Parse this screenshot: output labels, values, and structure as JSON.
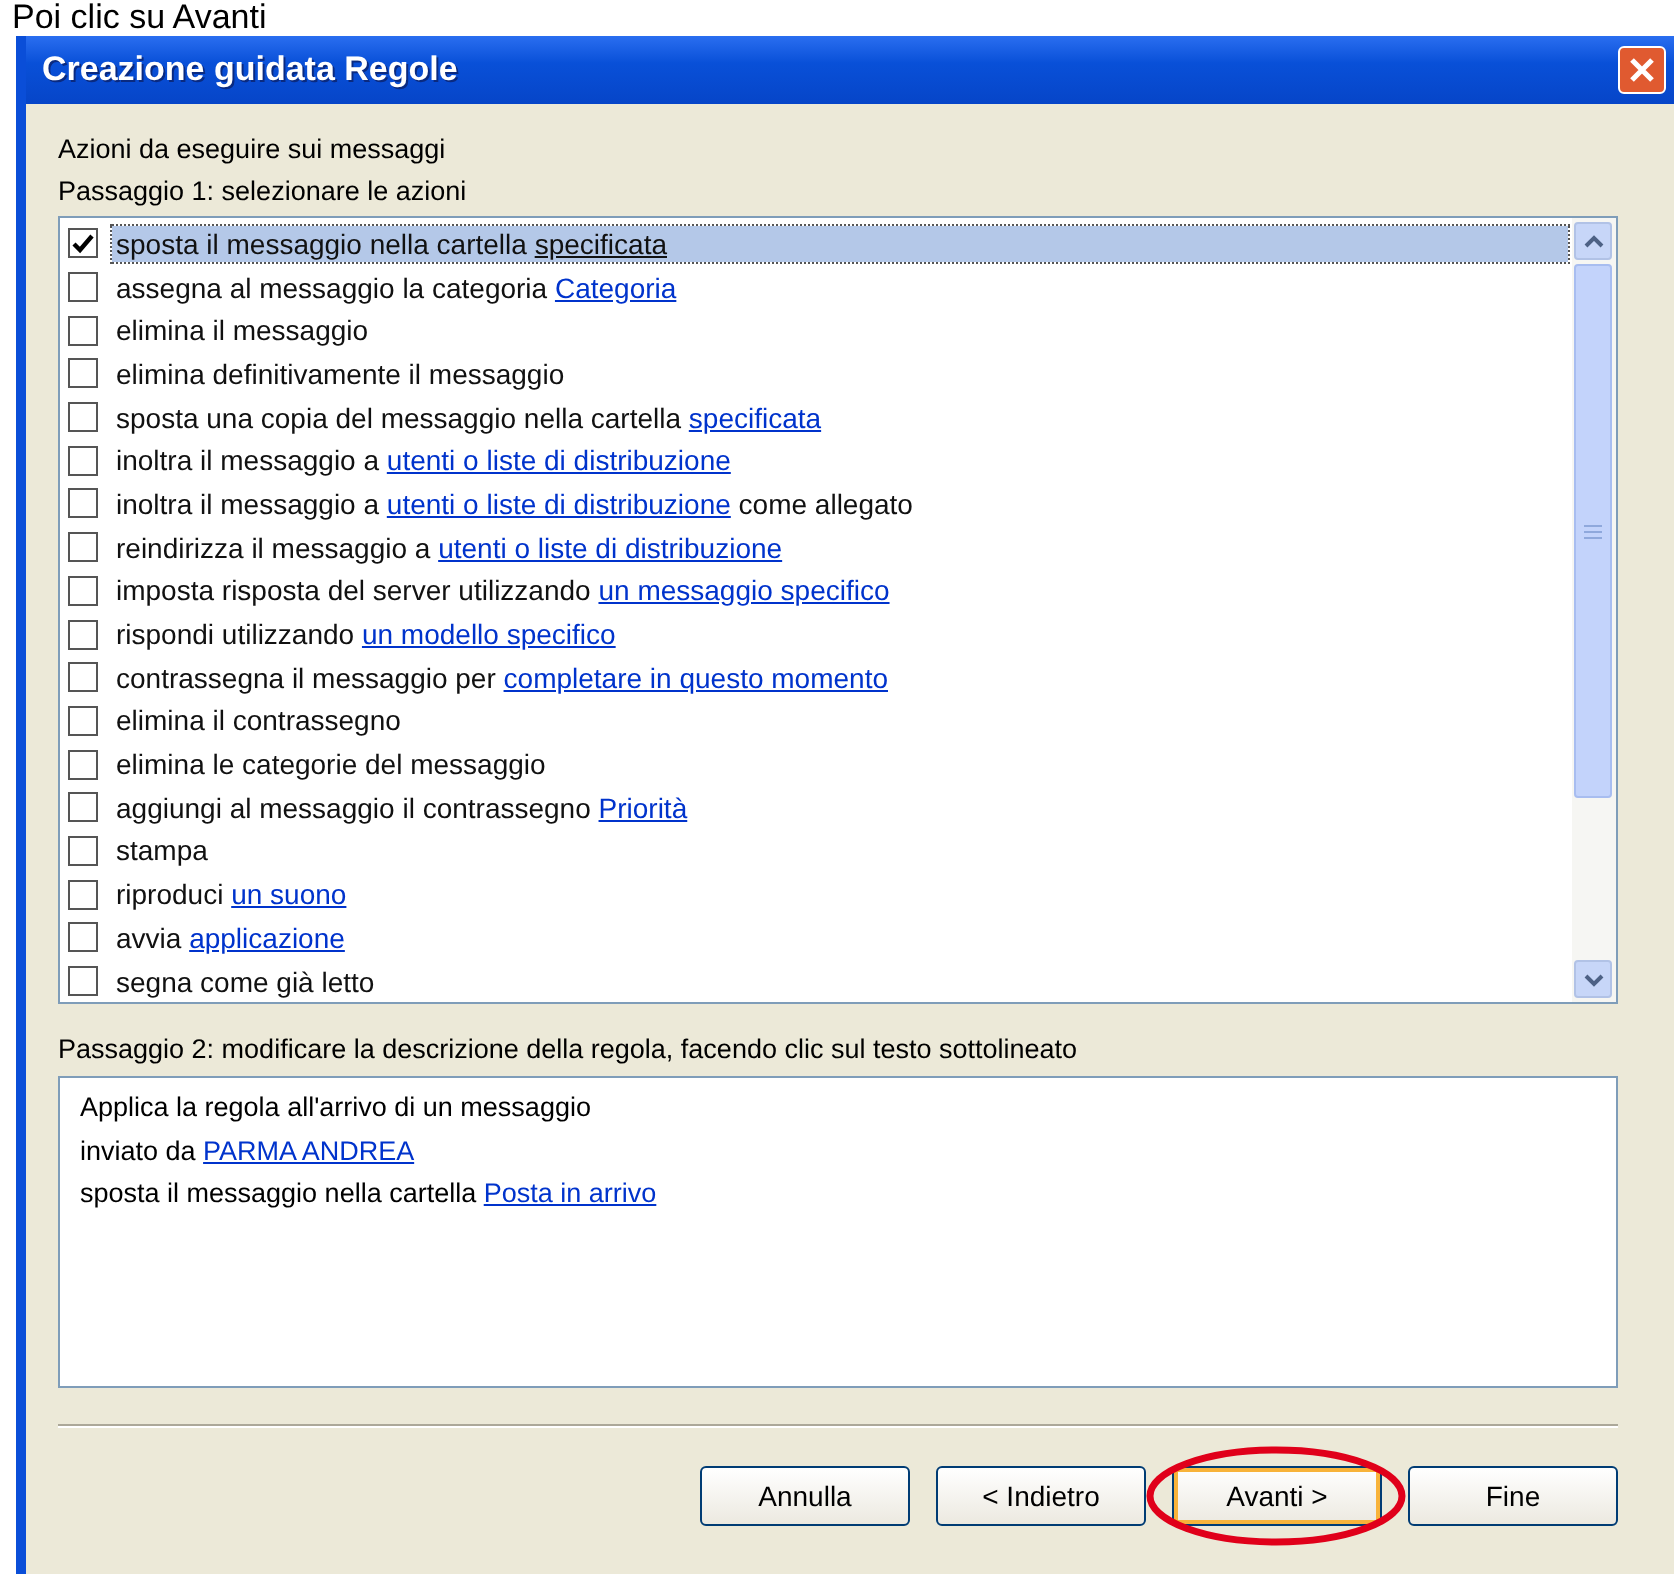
{
  "caption": "Poi clic su Avanti",
  "window": {
    "title": "Creazione guidata Regole"
  },
  "heading": "Azioni da eseguire sui messaggi",
  "step1": "Passaggio 1: selezionare le azioni",
  "actions": [
    {
      "text": "sposta il messaggio nella cartella ",
      "link": "specificata",
      "checked": true,
      "selected": true
    },
    {
      "text": "assegna al messaggio la categoria ",
      "link": "Categoria",
      "checked": false,
      "selected": false
    },
    {
      "text": "elimina il messaggio",
      "checked": false,
      "selected": false
    },
    {
      "text": "elimina definitivamente il messaggio",
      "checked": false,
      "selected": false
    },
    {
      "text": "sposta una copia del messaggio nella cartella ",
      "link": "specificata",
      "checked": false,
      "selected": false
    },
    {
      "text": "inoltra il messaggio a ",
      "link": "utenti o liste di distribuzione",
      "checked": false,
      "selected": false
    },
    {
      "text": "inoltra il messaggio a ",
      "link": "utenti o liste di distribuzione",
      "after": " come allegato",
      "checked": false,
      "selected": false
    },
    {
      "text": "reindirizza il messaggio a ",
      "link": "utenti o liste di distribuzione",
      "checked": false,
      "selected": false
    },
    {
      "text": "imposta risposta del server utilizzando ",
      "link": "un messaggio specifico",
      "checked": false,
      "selected": false
    },
    {
      "text": "rispondi utilizzando ",
      "link": "un modello specifico",
      "checked": false,
      "selected": false
    },
    {
      "text": "contrassegna il messaggio per ",
      "link": "completare in questo momento",
      "checked": false,
      "selected": false
    },
    {
      "text": "elimina il contrassegno",
      "checked": false,
      "selected": false
    },
    {
      "text": "elimina le categorie del messaggio",
      "checked": false,
      "selected": false
    },
    {
      "text": "aggiungi al messaggio il contrassegno ",
      "link": "Priorità",
      "checked": false,
      "selected": false
    },
    {
      "text": "stampa",
      "checked": false,
      "selected": false
    },
    {
      "text": "riproduci ",
      "link": "un suono",
      "checked": false,
      "selected": false
    },
    {
      "text": "avvia ",
      "link": "applicazione",
      "checked": false,
      "selected": false
    },
    {
      "text": "segna come già letto",
      "checked": false,
      "selected": false
    }
  ],
  "step2": "Passaggio 2: modificare la descrizione della regola, facendo clic sul testo sottolineato",
  "description": [
    {
      "text": "Applica la regola all'arrivo di un messaggio"
    },
    {
      "text": "inviato da ",
      "link": "PARMA ANDREA"
    },
    {
      "text": "sposta il messaggio nella cartella ",
      "link": "Posta in arrivo"
    }
  ],
  "buttons": [
    {
      "label": "Annulla",
      "highlighted": false,
      "focused": false
    },
    {
      "label": "< Indietro",
      "highlighted": false,
      "focused": false
    },
    {
      "label": "Avanti >",
      "highlighted": true,
      "focused": true
    },
    {
      "label": "Fine",
      "highlighted": false,
      "focused": false
    }
  ]
}
